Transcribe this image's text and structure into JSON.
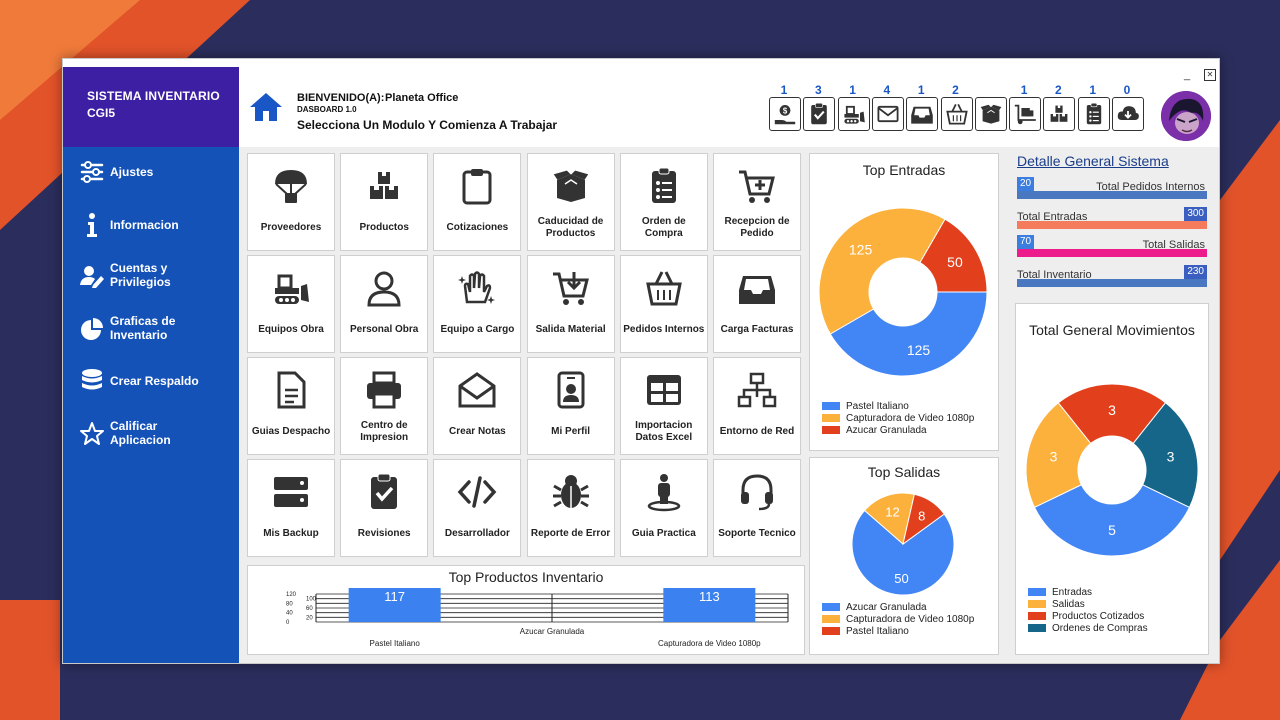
{
  "app": {
    "name": "SISTEMA INVENTARIO",
    "sub": "CGI5"
  },
  "sidebar": {
    "items": [
      {
        "label": "Ajustes",
        "icon": "sliders-icon"
      },
      {
        "label": "Informacion",
        "icon": "info-icon"
      },
      {
        "label": "Cuentas y Privilegios",
        "icon": "user-edit-icon"
      },
      {
        "label": "Graficas de Inventario",
        "icon": "pie-chart-icon"
      },
      {
        "label": "Crear Respaldo",
        "icon": "database-icon"
      },
      {
        "label": "Calificar Aplicacion",
        "icon": "star-icon"
      }
    ]
  },
  "header": {
    "welcome": "BIENVENIDO(A):",
    "user": "Planeta Office",
    "version": "DASBOARD 1.0",
    "prompt": "Selecciona Un Modulo Y Comienza  A Trabajar"
  },
  "quick_icons": [
    {
      "icon": "money-hand-icon",
      "count": "1"
    },
    {
      "icon": "clipboard-check-icon",
      "count": "3"
    },
    {
      "icon": "bulldozer-icon",
      "count": "1"
    },
    {
      "icon": "envelope-icon",
      "count": "4"
    },
    {
      "icon": "inbox-icon",
      "count": "1"
    },
    {
      "icon": "basket-icon",
      "count": "2"
    },
    {
      "icon": "open-box-icon",
      "count": ""
    },
    {
      "icon": "dolly-icon",
      "count": "1"
    },
    {
      "icon": "boxes-icon",
      "count": "2"
    },
    {
      "icon": "clipboard-list-icon",
      "count": "1"
    },
    {
      "icon": "cloud-download-icon",
      "count": "0"
    }
  ],
  "window_controls": {
    "minimize": "_",
    "close": "✕"
  },
  "tiles": [
    {
      "label": "Proveedores",
      "icon": "parachute-box-icon"
    },
    {
      "label": "Productos",
      "icon": "boxes-icon"
    },
    {
      "label": "Cotizaciones",
      "icon": "clipboard-icon"
    },
    {
      "label": "Caducidad de Productos",
      "icon": "open-box-icon"
    },
    {
      "label": "Orden de Compra",
      "icon": "clipboard-list-icon"
    },
    {
      "label": "Recepcion de Pedido",
      "icon": "cart-plus-icon"
    },
    {
      "label": "Equipos Obra",
      "icon": "bulldozer-icon"
    },
    {
      "label": "Personal Obra",
      "icon": "user-icon"
    },
    {
      "label": "Equipo a Cargo",
      "icon": "hand-sparkles-icon"
    },
    {
      "label": "Salida Material",
      "icon": "cart-arrow-down-icon"
    },
    {
      "label": "Pedidos Internos",
      "icon": "basket-icon"
    },
    {
      "label": "Carga Facturas",
      "icon": "inbox-icon"
    },
    {
      "label": "Guias Despacho",
      "icon": "file-icon"
    },
    {
      "label": "Centro de Impresion",
      "icon": "printer-icon"
    },
    {
      "label": "Crear Notas",
      "icon": "envelope-open-icon"
    },
    {
      "label": "Mi Perfil",
      "icon": "id-badge-icon"
    },
    {
      "label": "Importacion Datos Excel",
      "icon": "table-icon"
    },
    {
      "label": "Entorno de Red",
      "icon": "network-icon"
    },
    {
      "label": "Mis Backup",
      "icon": "server-icon"
    },
    {
      "label": "Revisiones",
      "icon": "clipboard-check-icon"
    },
    {
      "label": "Desarrollador",
      "icon": "code-icon"
    },
    {
      "label": "Reporte de Error",
      "icon": "bug-icon"
    },
    {
      "label": "Guia Practica",
      "icon": "street-view-icon"
    },
    {
      "label": "Soporte Tecnico",
      "icon": "headset-icon"
    }
  ],
  "colors": {
    "blue": "#4285f4",
    "orange": "#fbb13c",
    "red": "#e2401c",
    "teal": "#16668a",
    "pink": "#ec1c8c",
    "sidebar": "#1452b8",
    "brand": "#3d1fa3"
  },
  "top_productos": {
    "title": "Top Productos Inventario",
    "chart_data": {
      "type": "bar",
      "categories": [
        "Pastel Italiano",
        "Azucar Granulada",
        "Capturadora de Video 1080p"
      ],
      "values": [
        117,
        null,
        113
      ],
      "data_labels": [
        "117",
        "113"
      ],
      "yticks_a": [
        "120",
        "80",
        "40",
        "0"
      ],
      "yticks_b": [
        "100",
        "60",
        "20"
      ],
      "ylim": [
        0,
        120
      ]
    }
  },
  "top_entradas": {
    "title": "Top Entradas",
    "chart_data": {
      "type": "pie",
      "labels": [
        "Pastel Italiano",
        "Capturadora de Video 1080p",
        "Azucar Granulada"
      ],
      "values": [
        125,
        125,
        50
      ]
    }
  },
  "top_salidas": {
    "title": "Top Salidas",
    "chart_data": {
      "type": "pie",
      "labels": [
        "Azucar Granulada",
        "Capturadora de Video 1080p",
        "Pastel Italiano"
      ],
      "values": [
        50,
        12,
        8
      ]
    }
  },
  "detalle": {
    "title": "Detalle General Sistema",
    "rows": [
      {
        "label": "Total Pedidos Internos",
        "value": "20",
        "level": 0.07,
        "color": "#4a78c0"
      },
      {
        "label": "Total Entradas",
        "value": "300",
        "level": 1.0,
        "color": "#f47c5c"
      },
      {
        "label": "Total Salidas",
        "value": "70",
        "level": 0.23,
        "color": "#ec1c8c"
      },
      {
        "label": "Total Inventario",
        "value": "230",
        "level": 0.77,
        "color": "#4a78c0"
      }
    ]
  },
  "movimientos": {
    "title": "Total General Movimientos",
    "chart_data": {
      "type": "pie",
      "labels": [
        "Entradas",
        "Salidas",
        "Productos Cotizados",
        "Ordenes de Compras"
      ],
      "values": [
        5,
        3,
        3,
        3
      ]
    }
  }
}
